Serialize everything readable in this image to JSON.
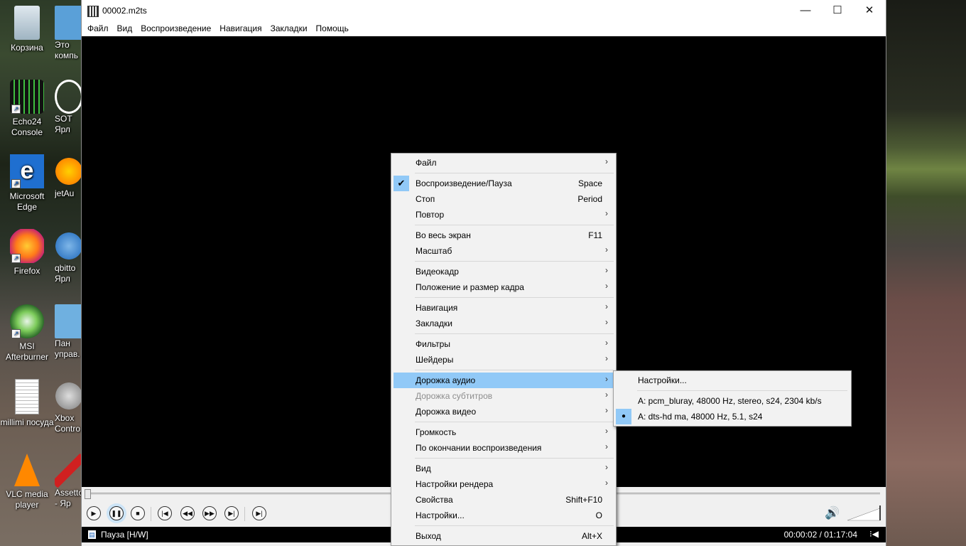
{
  "desktop": {
    "icons": [
      {
        "label": "Корзина"
      },
      {
        "label": "Echo24 Console"
      },
      {
        "label": "Microsoft Edge"
      },
      {
        "label": "Firefox"
      },
      {
        "label": "MSI Afterburner"
      },
      {
        "label": "millimi посуда"
      },
      {
        "label": "VLC media player"
      }
    ],
    "icons_col2": [
      {
        "label": "Это компь"
      },
      {
        "label": "SOT Ярл"
      },
      {
        "label": "jetAu"
      },
      {
        "label": "qbitto Ярл"
      },
      {
        "label": "Пан управ."
      },
      {
        "label": "Xbox Contro"
      },
      {
        "label": "Assetto - Яр"
      }
    ]
  },
  "window": {
    "title": "00002.m2ts",
    "controls": {
      "minimize": "—",
      "maximize": "☐",
      "close": "✕"
    }
  },
  "menubar": [
    "Файл",
    "Вид",
    "Воспроизведение",
    "Навигация",
    "Закладки",
    "Помощь"
  ],
  "context_menu": {
    "items": [
      {
        "label": "Файл",
        "shortcut": "",
        "submenu": true
      },
      {
        "label": "Воспроизведение/Пауза",
        "shortcut": "Space",
        "checked": true
      },
      {
        "label": "Стоп",
        "shortcut": "Period"
      },
      {
        "label": "Повтор",
        "shortcut": "",
        "submenu": true
      },
      {
        "label": "Во весь экран",
        "shortcut": "F11"
      },
      {
        "label": "Масштаб",
        "shortcut": "",
        "submenu": true
      },
      {
        "label": "Видеокадр",
        "shortcut": "",
        "submenu": true
      },
      {
        "label": "Положение и размер кадра",
        "shortcut": "",
        "submenu": true
      },
      {
        "label": "Навигация",
        "shortcut": "",
        "submenu": true
      },
      {
        "label": "Закладки",
        "shortcut": "",
        "submenu": true
      },
      {
        "label": "Фильтры",
        "shortcut": "",
        "submenu": true
      },
      {
        "label": "Шейдеры",
        "shortcut": "",
        "submenu": true
      },
      {
        "label": "Дорожка аудио",
        "shortcut": "",
        "submenu": true,
        "highlighted": true
      },
      {
        "label": "Дорожка субтитров",
        "shortcut": "",
        "submenu": true,
        "disabled": true
      },
      {
        "label": "Дорожка видео",
        "shortcut": "",
        "submenu": true
      },
      {
        "label": "Громкость",
        "shortcut": "",
        "submenu": true
      },
      {
        "label": "По окончании воспроизведения",
        "shortcut": "",
        "submenu": true
      },
      {
        "label": "Вид",
        "shortcut": "",
        "submenu": true
      },
      {
        "label": "Настройки рендера",
        "shortcut": "",
        "submenu": true
      },
      {
        "label": "Свойства",
        "shortcut": "Shift+F10"
      },
      {
        "label": "Настройки...",
        "shortcut": "O"
      },
      {
        "label": "Выход",
        "shortcut": "Alt+X"
      }
    ]
  },
  "audio_submenu": {
    "settings_label": "Настройки...",
    "tracks": [
      {
        "label": "A: pcm_bluray, 48000 Hz, stereo, s24, 2304 kb/s",
        "selected": false
      },
      {
        "label": "A: dts-hd ma, 48000 Hz, 5.1, s24",
        "selected": true
      }
    ]
  },
  "playback": {
    "status": "Пауза [H/W]",
    "time": "00:00:02 / 01:17:04",
    "position_fraction": 0.0004
  },
  "colors": {
    "highlight": "#91c9f7",
    "video_bg": "#000000"
  }
}
